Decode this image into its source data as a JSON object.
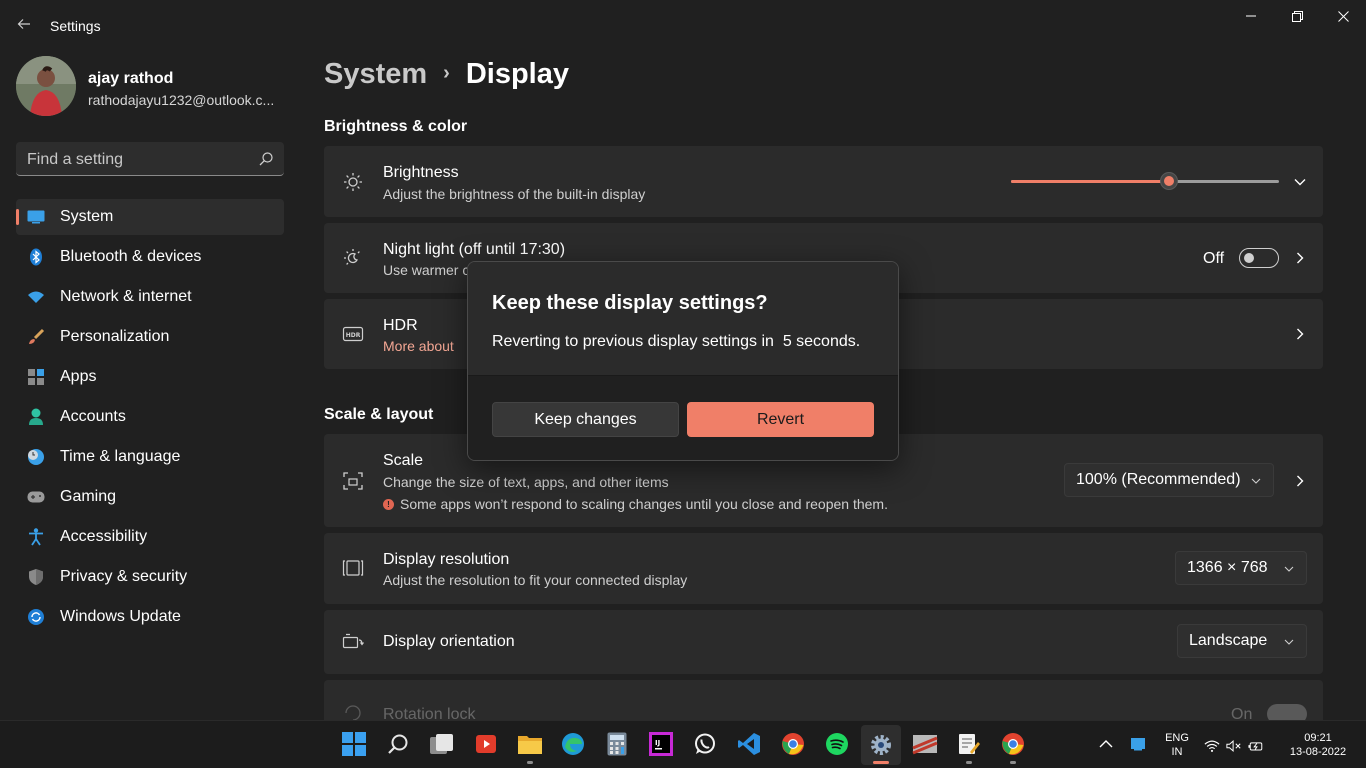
{
  "window": {
    "title": "Settings",
    "back_icon": "back-arrow-icon",
    "minimize_icon": "minimize-icon",
    "maximize_icon": "restore-icon",
    "close_icon": "close-icon"
  },
  "profile": {
    "name": "ajay rathod",
    "email": "rathodajayu1232@outlook.c..."
  },
  "search": {
    "placeholder": "Find a setting",
    "icon": "search-icon"
  },
  "sidebar": {
    "items": [
      {
        "label": "System",
        "icon": "system-icon",
        "active": true
      },
      {
        "label": "Bluetooth & devices",
        "icon": "bluetooth-icon"
      },
      {
        "label": "Network & internet",
        "icon": "wifi-icon"
      },
      {
        "label": "Personalization",
        "icon": "brush-icon"
      },
      {
        "label": "Apps",
        "icon": "apps-icon"
      },
      {
        "label": "Accounts",
        "icon": "person-icon"
      },
      {
        "label": "Time & language",
        "icon": "clock-globe-icon"
      },
      {
        "label": "Gaming",
        "icon": "gamepad-icon"
      },
      {
        "label": "Accessibility",
        "icon": "accessibility-icon"
      },
      {
        "label": "Privacy & security",
        "icon": "shield-icon"
      },
      {
        "label": "Windows Update",
        "icon": "update-icon"
      }
    ]
  },
  "breadcrumb": {
    "parent": "System",
    "separator": "›",
    "current": "Display"
  },
  "sections": {
    "brightness_color": "Brightness & color",
    "scale_layout": "Scale & layout"
  },
  "brightness": {
    "title": "Brightness",
    "subtitle": "Adjust the brightness of the built-in display",
    "level_fraction": 0.59
  },
  "night_light": {
    "title": "Night light (off until 17:30)",
    "subtitle": "Use warmer c",
    "state": "Off"
  },
  "hdr": {
    "title": "HDR",
    "link": "More about"
  },
  "scale": {
    "title": "Scale",
    "subtitle": "Change the size of text, apps, and other items",
    "warning": "Some apps won’t respond to scaling changes until you close and reopen them.",
    "value": "100% (Recommended)"
  },
  "resolution": {
    "title": "Display resolution",
    "subtitle": "Adjust the resolution to fit your connected display",
    "value": "1366 × 768"
  },
  "orientation": {
    "title": "Display orientation",
    "value": "Landscape"
  },
  "rotation_lock": {
    "title": "Rotation lock",
    "state": "On"
  },
  "dialog": {
    "title": "Keep these display settings?",
    "message": "Reverting to previous display settings in  5 seconds.",
    "keep_label": "Keep changes",
    "revert_label": "Revert"
  },
  "taskbar": {
    "apps": [
      {
        "name": "start",
        "icon": "windows-start-icon"
      },
      {
        "name": "search",
        "icon": "search-icon"
      },
      {
        "name": "task-view",
        "icon": "task-view-icon"
      },
      {
        "name": "media-player",
        "icon": "media-player-icon"
      },
      {
        "name": "file-explorer",
        "icon": "folder-icon"
      },
      {
        "name": "edge",
        "icon": "edge-icon"
      },
      {
        "name": "calculator",
        "icon": "calculator-icon"
      },
      {
        "name": "intellij",
        "icon": "intellij-icon"
      },
      {
        "name": "whatsapp",
        "icon": "whatsapp-icon"
      },
      {
        "name": "vscode",
        "icon": "vscode-icon"
      },
      {
        "name": "chrome",
        "icon": "chrome-icon"
      },
      {
        "name": "spotify",
        "icon": "spotify-icon"
      },
      {
        "name": "settings",
        "icon": "gear-icon"
      },
      {
        "name": "git",
        "icon": "git-icon"
      },
      {
        "name": "notepad",
        "icon": "notepad-icon"
      },
      {
        "name": "chrome-2",
        "icon": "chrome-icon"
      }
    ],
    "tray": {
      "lang_top": "ENG",
      "lang_bottom": "IN",
      "time": "09:21",
      "date": "13-08-2022"
    }
  },
  "colors": {
    "accent": "#f07f68",
    "background": "#202020",
    "card": "#2b2b2b"
  }
}
